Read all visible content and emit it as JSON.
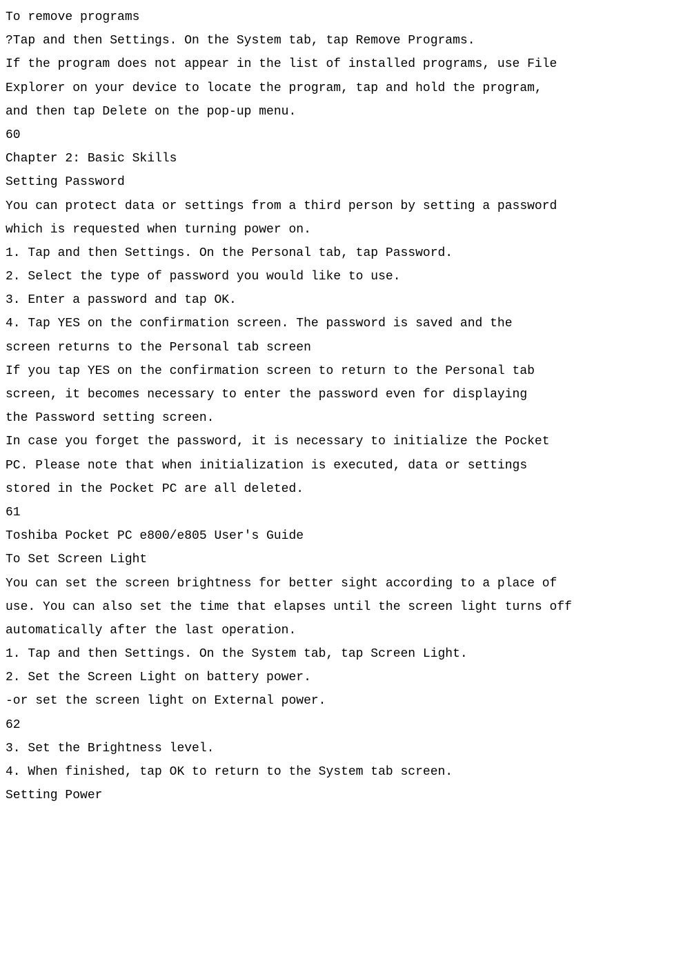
{
  "lines": [
    "To remove programs",
    "?Tap and then Settings. On the System tab, tap Remove Programs.",
    "If the program does not appear in the list of installed programs, use File",
    "Explorer on your device to locate the program, tap and hold the program,",
    "and then tap Delete on the pop-up menu.",
    "60",
    "Chapter 2: Basic Skills",
    "Setting Password",
    "You can protect data or settings from a third person by setting a password",
    "which is requested when turning power on.",
    "1. Tap and then Settings. On the Personal tab, tap Password.",
    "2. Select the type of password you would like to use.",
    "3. Enter a password and tap OK.",
    "4. Tap YES on the confirmation screen. The password is saved and the",
    "screen returns to the Personal tab screen",
    "If you tap YES on the confirmation screen to return to the Personal tab",
    "screen, it becomes necessary to enter the password even for displaying",
    "the Password setting screen.",
    "In case you forget the password, it is necessary to initialize the Pocket",
    "PC. Please note that when initialization is executed, data or settings",
    "stored in the Pocket PC are all deleted.",
    "61",
    "Toshiba Pocket PC e800/e805 User's Guide",
    "To Set Screen Light",
    "You can set the screen brightness for better sight according to a place of",
    "use. You can also set the time that elapses until the screen light turns off",
    "automatically after the last operation.",
    "1. Tap and then Settings. On the System tab, tap Screen Light.",
    "2. Set the Screen Light on battery power.",
    "-or set the screen light on External power.",
    "62",
    "3. Set the Brightness level.",
    "4. When finished, tap OK to return to the System tab screen.",
    "Setting Power"
  ]
}
